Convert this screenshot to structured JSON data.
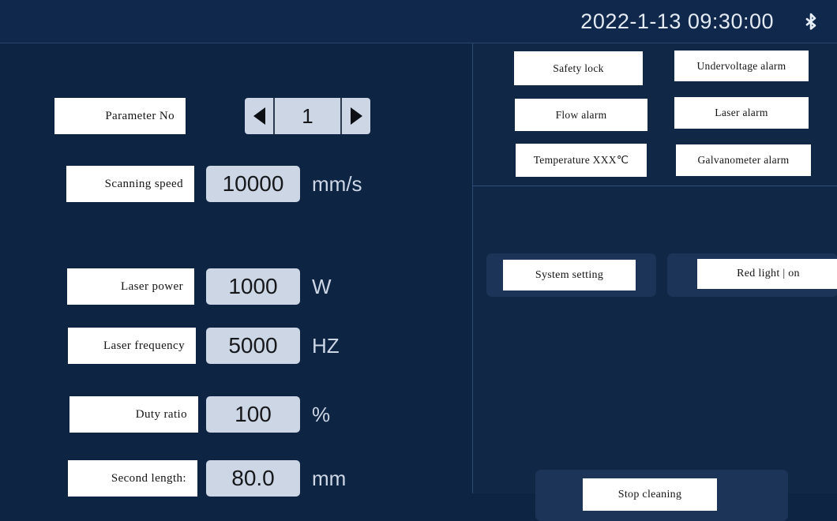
{
  "header": {
    "datetime": "2022-1-13 09:30:00",
    "bluetooth_icon": "bluetooth-icon"
  },
  "theme": {
    "background": "#0e2443",
    "header_background": "#10284b",
    "panel_background": "#102746",
    "divider": "#2f5180",
    "value_box": "#ccd6e4",
    "button_white": "#ffffff",
    "frame_blue": "#1b3458",
    "unit_text": "#cdd7e6"
  },
  "left_panel": {
    "parameter_no": {
      "label": "Parameter  No",
      "value": "1",
      "prev_icon": "triangle-left-icon",
      "next_icon": "triangle-right-icon"
    },
    "parameters": [
      {
        "label": "Scanning  speed",
        "value": "10000",
        "unit": "mm/s"
      },
      {
        "label": "Laser  power",
        "value": "1000",
        "unit": "W"
      },
      {
        "label": "Laser  frequency",
        "value": "5000",
        "unit": "HZ"
      },
      {
        "label": "Duty  ratio",
        "value": "100",
        "unit": "%"
      },
      {
        "label": "Second  length:",
        "value": "80.0",
        "unit": "mm"
      }
    ]
  },
  "right_panel": {
    "alarms": [
      {
        "label": "Safety lock"
      },
      {
        "label": "Undervoltage alarm"
      },
      {
        "label": "Flow alarm"
      },
      {
        "label": "Laser alarm"
      },
      {
        "label": "Temperature XXX℃"
      },
      {
        "label": "Galvanometer alarm"
      }
    ],
    "actions": [
      {
        "label": "System setting"
      },
      {
        "label": "Red light | on"
      }
    ],
    "stop_button": {
      "label": "Stop cleaning"
    }
  }
}
